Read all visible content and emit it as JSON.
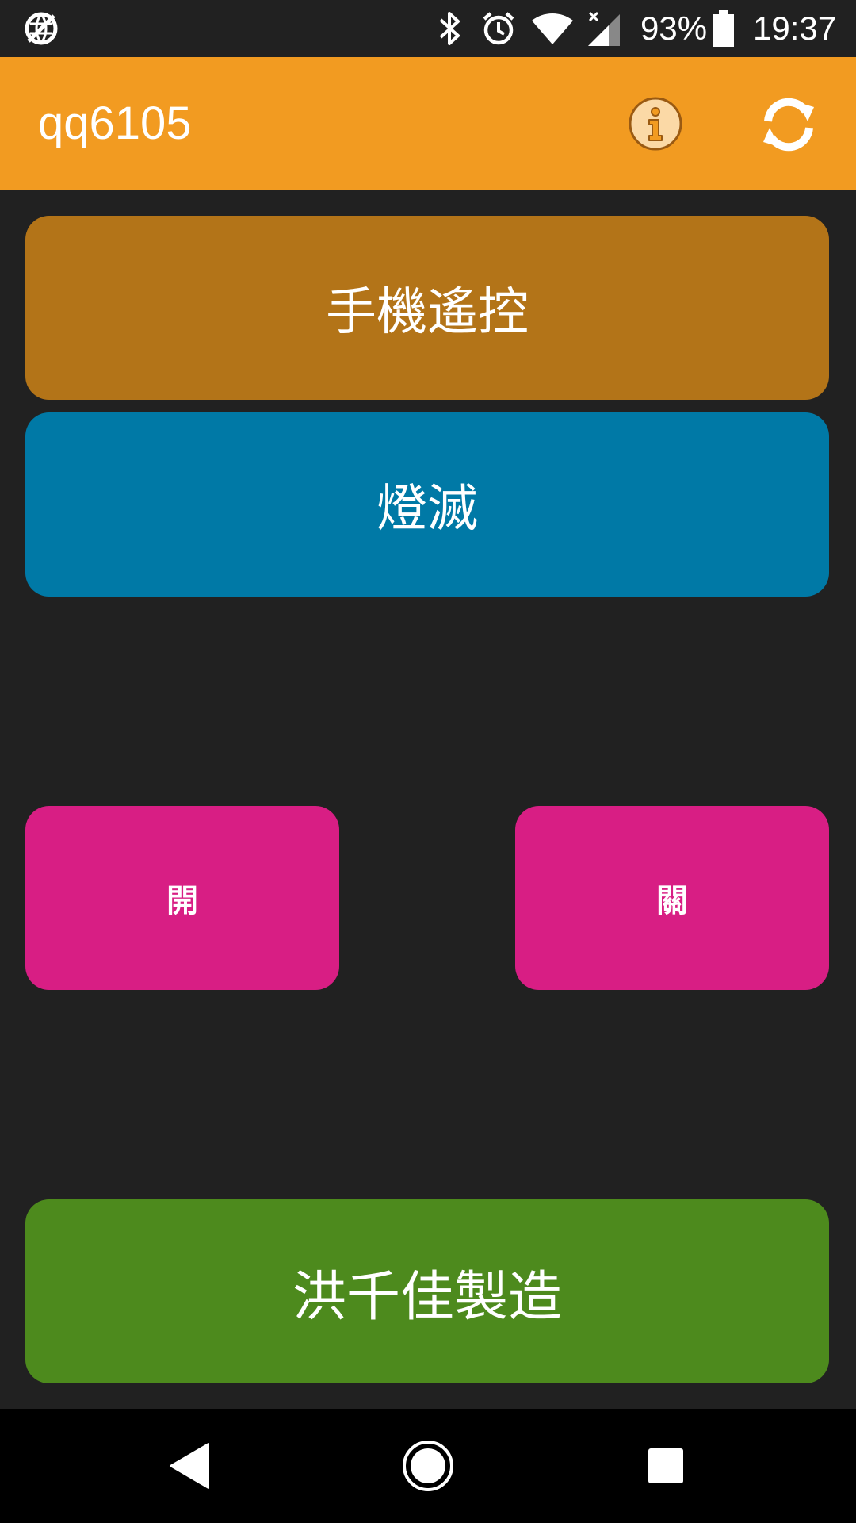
{
  "status_bar": {
    "battery_percent": "93%",
    "time": "19:37",
    "icons": [
      "data-saver-icon",
      "bluetooth-icon",
      "alarm-icon",
      "wifi-icon",
      "cell-signal-icon",
      "battery-icon"
    ]
  },
  "app_bar": {
    "title": "qq6105",
    "info_icon": "info-icon",
    "refresh_icon": "refresh-icon"
  },
  "buttons": {
    "remote_label": "手機遙控",
    "light_label": "燈滅",
    "on_label": "開",
    "off_label": "關",
    "maker_label": "洪千佳製造"
  },
  "colors": {
    "app_bar": "#F29B21",
    "remote_button": "#B37418",
    "light_button": "#0079A6",
    "switch_buttons": "#D81E84",
    "maker_button": "#4D8A1D",
    "background": "#212121"
  },
  "nav_bar": {
    "icons": [
      "back-icon",
      "home-icon",
      "recents-icon"
    ]
  }
}
